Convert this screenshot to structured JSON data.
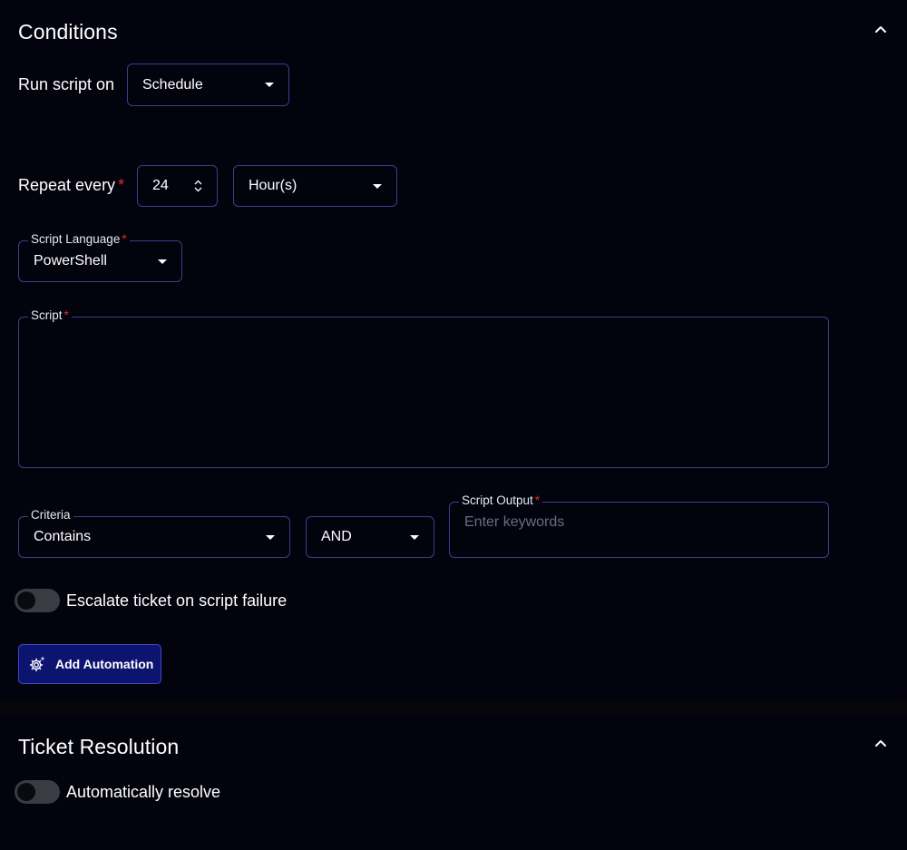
{
  "conditions": {
    "title": "Conditions",
    "run_script_label": "Run script on",
    "run_script_value": "Schedule",
    "repeat_label": "Repeat every",
    "repeat_required": "*",
    "repeat_value": "24",
    "repeat_unit": "Hour(s)",
    "script_language": {
      "label": "Script Language",
      "required": "*",
      "value": "PowerShell"
    },
    "script": {
      "label": "Script",
      "required": "*",
      "value": ""
    },
    "criteria": {
      "label": "Criteria",
      "value": "Contains"
    },
    "operator": {
      "value": "AND"
    },
    "script_output": {
      "label": "Script Output",
      "required": "*",
      "placeholder": "Enter keywords"
    },
    "escalate_toggle": {
      "label": "Escalate ticket on script failure",
      "on": false
    },
    "add_automation_label": "Add Automation"
  },
  "resolution": {
    "title": "Ticket Resolution",
    "auto_resolve_toggle": {
      "label": "Automatically resolve",
      "on": false
    }
  },
  "icons": {
    "collapse": "chevron-up-icon",
    "dropdown": "caret-down-icon",
    "stepper": "stepper-icon",
    "automation": "gear-sparkle-icon"
  },
  "colors": {
    "background": "#03030e",
    "field_border": "#3a3f8a",
    "required": "#e0302f",
    "primary_button": "#0c1470",
    "toggle_track": "#3a3c44"
  }
}
